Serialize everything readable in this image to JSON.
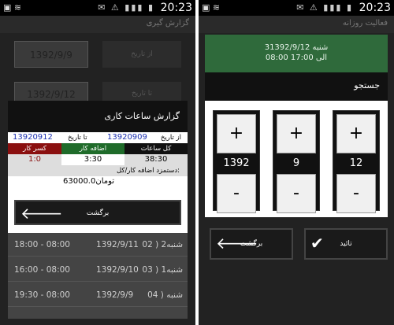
{
  "left": {
    "status": {
      "time": "20:23",
      "icons": "✉ ⚠ ▮▮▮ ▮"
    },
    "titlebar": "گزارش گیری",
    "bg_form": {
      "from_label": "از تاریخ",
      "from_value": "1392/9/9",
      "to_label": "تا تاریخ",
      "to_value": "1392/9/12"
    },
    "report": {
      "title": "گزارش ساعات کاری",
      "from_label": "از تاریخ",
      "from_value": "13920909",
      "to_label": "تا تاریخ",
      "to_value": "13920912",
      "headers": [
        "کسر کار",
        "اضافه کار",
        "کل ساعات"
      ],
      "values": [
        "1:0",
        "3:30",
        "38:30"
      ],
      "note": "دستمزد اضافه کار/کل:",
      "amount": "63000.0تومان",
      "back_label": "برگشت"
    },
    "rows": [
      {
        "day": "02 ) 2شنبه",
        "date": "1392/9/11",
        "time": "18:00 - 08:00"
      },
      {
        "day": "03 ) 1شنبه",
        "date": "1392/9/10",
        "time": "16:00 - 08:00"
      },
      {
        "day": "04 ) شنبه",
        "date": "1392/9/9",
        "time": "19:30 - 08:00"
      }
    ]
  },
  "right": {
    "status": {
      "time": "20:23",
      "icons": "✉ ⚠ ▮▮▮ ▮"
    },
    "titlebar": "فعالیت روزانه",
    "card": {
      "line1": "3شنبه 1392/9/12",
      "line2": "08:00 الی 17:00"
    },
    "search_title": "جستجو",
    "pickers": [
      {
        "plus": "+",
        "value": "1392",
        "minus": "-"
      },
      {
        "plus": "+",
        "value": "9",
        "minus": "-"
      },
      {
        "plus": "+",
        "value": "12",
        "minus": "-"
      }
    ],
    "back_label": "برگشت",
    "confirm_label": "تائید"
  },
  "colors": {
    "accent_blue": "#1a2fb0",
    "header_green": "#1f6b2a",
    "header_red": "#8a0f0f",
    "card_green": "#2f6a3b"
  }
}
